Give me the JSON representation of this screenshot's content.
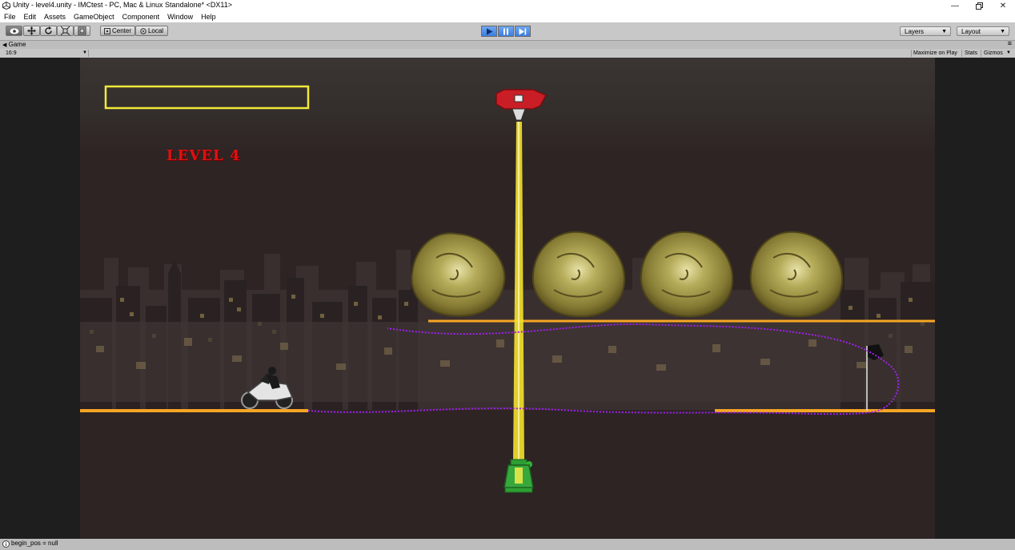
{
  "window": {
    "title": "Unity - level4.unity - IMCtest - PC, Mac & Linux Standalone* <DX11>"
  },
  "menu": [
    "File",
    "Edit",
    "Assets",
    "GameObject",
    "Component",
    "Window",
    "Help"
  ],
  "toolbar": {
    "pivot_label": "Center",
    "space_label": "Local",
    "layers_label": "Layers",
    "layout_label": "Layout"
  },
  "game_view": {
    "tab_label": "Game",
    "aspect": "16:9",
    "maximize_label": "Maximize on Play",
    "stats_label": "Stats",
    "gizmos_label": "Gizmos"
  },
  "game": {
    "level_text": "LEVEL 4"
  },
  "status": {
    "message": "begin_pos = null"
  },
  "colors": {
    "accent_blue": "#3c7de0",
    "track_yellow": "#f6a623",
    "laser_yellow": "#f3e12c",
    "path_purple": "#a020f0",
    "level_red": "#e01010"
  }
}
